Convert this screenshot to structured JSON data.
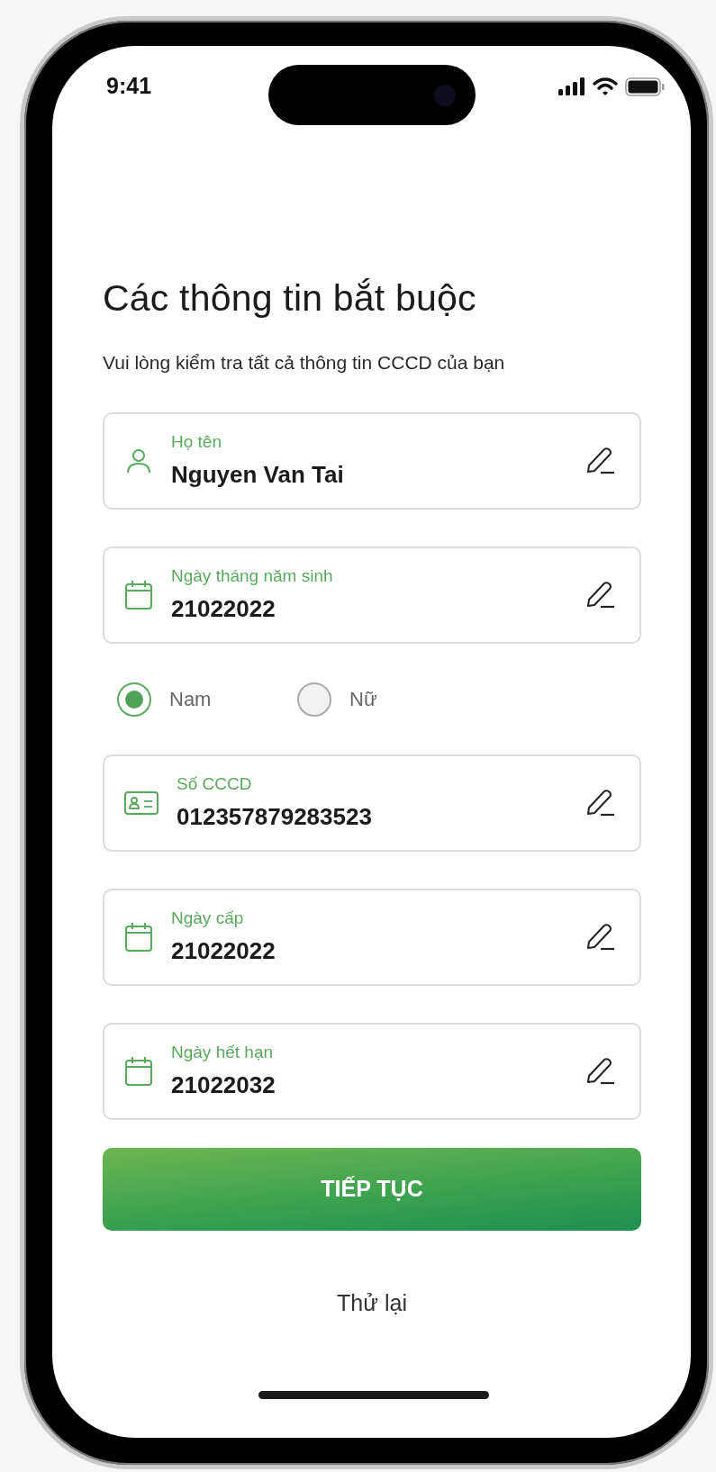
{
  "status_bar": {
    "time": "9:41"
  },
  "title": "Các thông tin bắt buộc",
  "subtitle": "Vui lòng kiểm tra tất cả thông tin CCCD của bạn",
  "form": [
    {
      "kind": "name",
      "label": "Họ tên",
      "value": "Nguyen Van Tai"
    },
    {
      "kind": "date",
      "label": "Ngày tháng năm sinh",
      "value": "21022022"
    },
    {
      "kind": "gender",
      "options": [
        {
          "label": "Nam",
          "selected": true
        },
        {
          "label": "Nữ",
          "selected": false
        }
      ]
    },
    {
      "kind": "idnumber",
      "label": "Số CCCD",
      "value": "012357879283523"
    },
    {
      "kind": "date",
      "label": "Ngày cấp",
      "value": "21022022"
    },
    {
      "kind": "date",
      "label": "Ngày hết hạn",
      "value": "21022032"
    }
  ],
  "continue_button": "TIẾP TỤC",
  "retry_link": "Thử lại"
}
